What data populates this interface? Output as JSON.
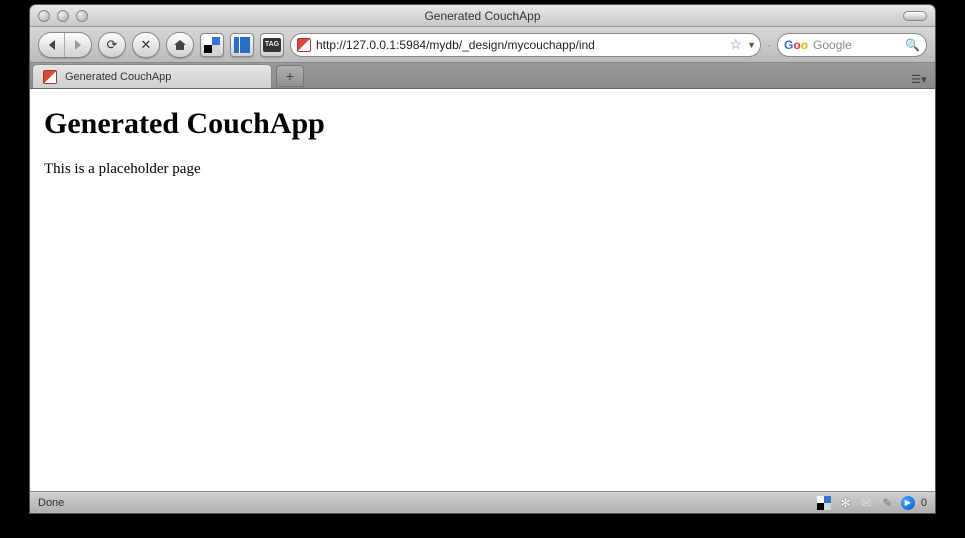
{
  "window": {
    "title": "Generated CouchApp"
  },
  "toolbar": {
    "url": "http://127.0.0.1:5984/mydb/_design/mycouchapp/ind",
    "search_placeholder": "Google",
    "bookmarklet_tag": "TAG"
  },
  "tabs": {
    "active_label": "Generated CouchApp"
  },
  "page": {
    "heading": "Generated CouchApp",
    "body": "This is a placeholder page"
  },
  "status": {
    "text": "Done",
    "count": "0"
  }
}
